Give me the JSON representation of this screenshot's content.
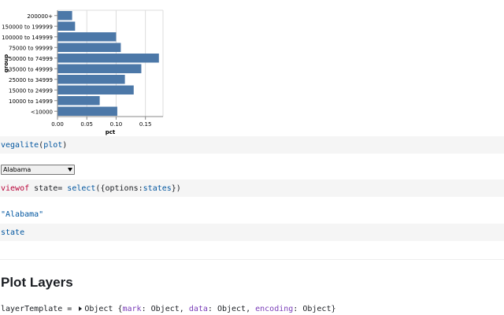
{
  "chart_data": {
    "type": "bar",
    "orientation": "horizontal",
    "categories": [
      "200000+",
      "150000 to 199999",
      "100000 to 149999",
      "75000 to 99999",
      "50000 to 74999",
      "35000 to 49999",
      "25000 to 34999",
      "15000 to 24999",
      "10000 to 14999",
      "<10000"
    ],
    "values": [
      0.025,
      0.03,
      0.1,
      0.108,
      0.173,
      0.143,
      0.115,
      0.13,
      0.072,
      0.102
    ],
    "xlabel": "pct",
    "ylabel": "group",
    "xlim": [
      0,
      0.18
    ],
    "xticks": [
      "0.00",
      "0.05",
      "0.10",
      "0.15"
    ],
    "grid": true,
    "bar_color": "#4c78a8"
  },
  "cells": {
    "vegalite": {
      "fn": "vegalite",
      "open": "(",
      "arg": "plot",
      "close": ")"
    },
    "select_value": "Alabama",
    "viewof": {
      "keyword": "viewof",
      "name": " state= ",
      "fn": "select",
      "open": "({",
      "prop": "options",
      "colon": ":",
      "arg": "states",
      "close": "})"
    },
    "state_output": "\"Alabama\"",
    "state_ref": "state",
    "heading": "Plot Layers",
    "layer": {
      "name": "layerTemplate = ",
      "type": "Object {",
      "k1": "mark",
      "v1": ": Object, ",
      "k2": "data",
      "v2": ": Object, ",
      "k3": "encoding",
      "v3": ": Object}"
    }
  },
  "colors": {
    "cell_bg": "#f5f5f5",
    "fn_blue": "#00559f",
    "keyword_red": "#b80037",
    "prop_purple": "#7a3db8"
  }
}
